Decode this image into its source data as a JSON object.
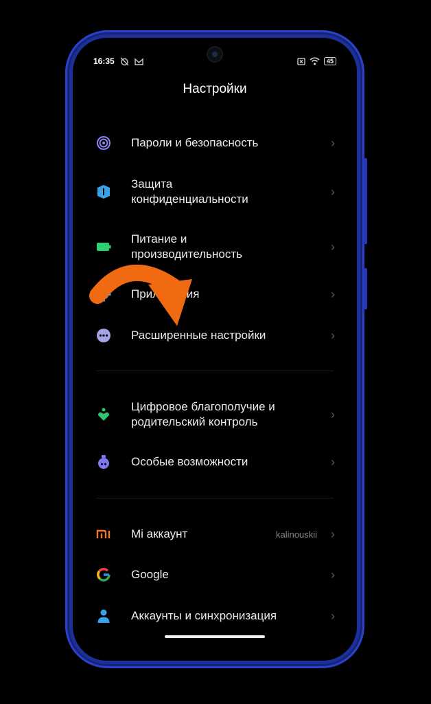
{
  "status": {
    "time": "16:35",
    "battery": "45"
  },
  "title": "Настройки",
  "items": [
    {
      "label": "Пароли и безопасность"
    },
    {
      "label": "Защита\nконфиденциальности"
    },
    {
      "label": "Питание и\nпроизводительность"
    },
    {
      "label": "Приложения"
    },
    {
      "label": "Расширенные настройки"
    },
    {
      "label": "Цифровое благополучие и\nродительский контроль"
    },
    {
      "label": "Особые возможности"
    },
    {
      "label": "Mi аккаунт",
      "value": "kalinouskii"
    },
    {
      "label": "Google"
    },
    {
      "label": "Аккаунты и синхронизация"
    }
  ],
  "colors": {
    "frame": "#1c2f9a",
    "accent_arrow": "#f06a12",
    "fingerprint": "#8e84f5",
    "shield": "#3aa0e8",
    "battery": "#2fd06f",
    "gear": "#3aa0e8",
    "more": "#a7a3e8",
    "wellbeing": "#2fc66f",
    "accessibility": "#8177ee",
    "mi": "#f07a28",
    "account": "#3aa0e8"
  },
  "icons": [
    "fingerprint-icon",
    "shield-icon",
    "battery-icon",
    "gear-icon",
    "more-dots-icon",
    "wellbeing-icon",
    "accessibility-icon",
    "mi-logo-icon",
    "google-icon",
    "person-icon",
    "chevron-right-icon"
  ]
}
